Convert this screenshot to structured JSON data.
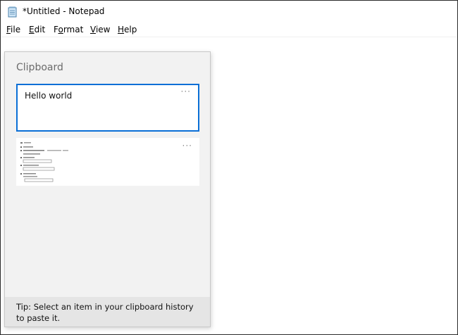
{
  "window": {
    "title": "*Untitled - Notepad"
  },
  "menu": [
    {
      "label": "File",
      "underline": "F",
      "rest": "ile"
    },
    {
      "label": "Edit",
      "underline": "E",
      "rest": "dit"
    },
    {
      "label": "Format",
      "underline": "",
      "pre": "F",
      "u2": "o",
      "post": "rmat"
    },
    {
      "label": "View",
      "underline": "V",
      "rest": "iew"
    },
    {
      "label": "Help",
      "underline": "H",
      "rest": "elp"
    }
  ],
  "clipboard": {
    "title": "Clipboard",
    "items": [
      {
        "type": "text",
        "text": "Hello world",
        "selected": true
      },
      {
        "type": "image",
        "selected": false
      }
    ],
    "more_symbol": "···",
    "tip": "Tip: Select an item in your clipboard history to paste it."
  },
  "colors": {
    "accent": "#0a6fd6",
    "panel": "#f2f2f2",
    "tip_bg": "#e5e5e5"
  }
}
